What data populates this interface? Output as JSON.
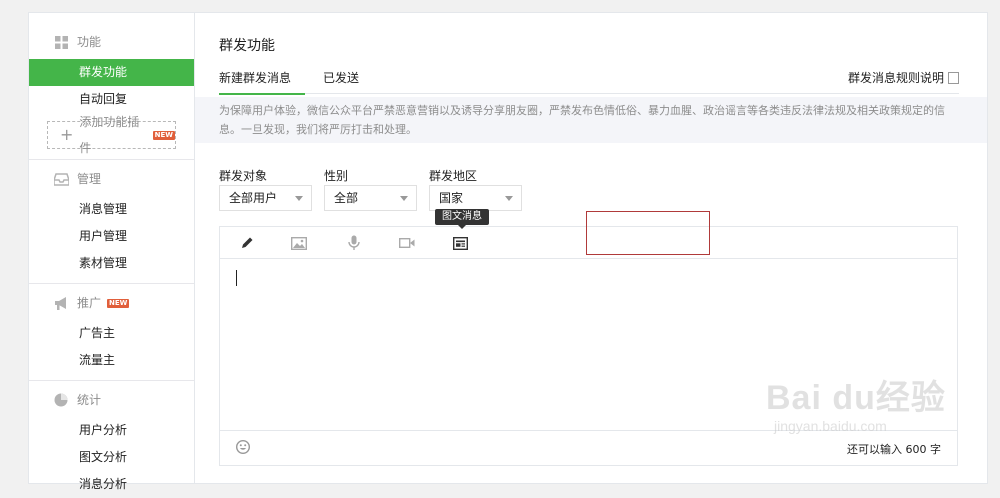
{
  "sidebar": {
    "groups": [
      {
        "title": "功能",
        "icon": "grid-icon",
        "items": [
          {
            "label": "群发功能",
            "active": true
          },
          {
            "label": "自动回复",
            "active": false
          }
        ],
        "add_plugin": {
          "label": "添加功能插件",
          "badge": "NEW"
        }
      },
      {
        "title": "管理",
        "icon": "inbox-icon",
        "items": [
          {
            "label": "消息管理"
          },
          {
            "label": "用户管理"
          },
          {
            "label": "素材管理"
          }
        ]
      },
      {
        "title": "推广",
        "icon": "megaphone-icon",
        "badge": "NEW",
        "items": [
          {
            "label": "广告主"
          },
          {
            "label": "流量主"
          }
        ]
      },
      {
        "title": "统计",
        "icon": "pie-chart-icon",
        "items": [
          {
            "label": "用户分析"
          },
          {
            "label": "图文分析"
          },
          {
            "label": "消息分析"
          }
        ]
      }
    ]
  },
  "main": {
    "title": "群发功能",
    "tabs": [
      {
        "label": "新建群发消息",
        "active": true
      },
      {
        "label": "已发送",
        "active": false
      }
    ],
    "rules_link": "群发消息规则说明",
    "notice": "为保障用户体验，微信公众平台严禁恶意营销以及诱导分享朋友圈，严禁发布色情低俗、暴力血腥、政治谣言等各类违反法律法规及相关政策规定的信息。一旦发现，我们将严厉打击和处理。",
    "filters": [
      {
        "label": "群发对象",
        "value": "全部用户"
      },
      {
        "label": "性别",
        "value": "全部"
      },
      {
        "label": "群发地区",
        "value": "国家"
      }
    ],
    "toolbar": {
      "tools": [
        "pencil-icon",
        "image-icon",
        "microphone-icon",
        "video-icon",
        "news-card-icon"
      ],
      "tooltip": "图文消息"
    },
    "editor": {
      "counter": "还可以输入 600 字"
    }
  },
  "watermark": {
    "text": "Bai du经验",
    "sub": "jingyan.baidu.com"
  },
  "colors": {
    "accent": "#44b549",
    "highlight": "#b03a3a"
  }
}
